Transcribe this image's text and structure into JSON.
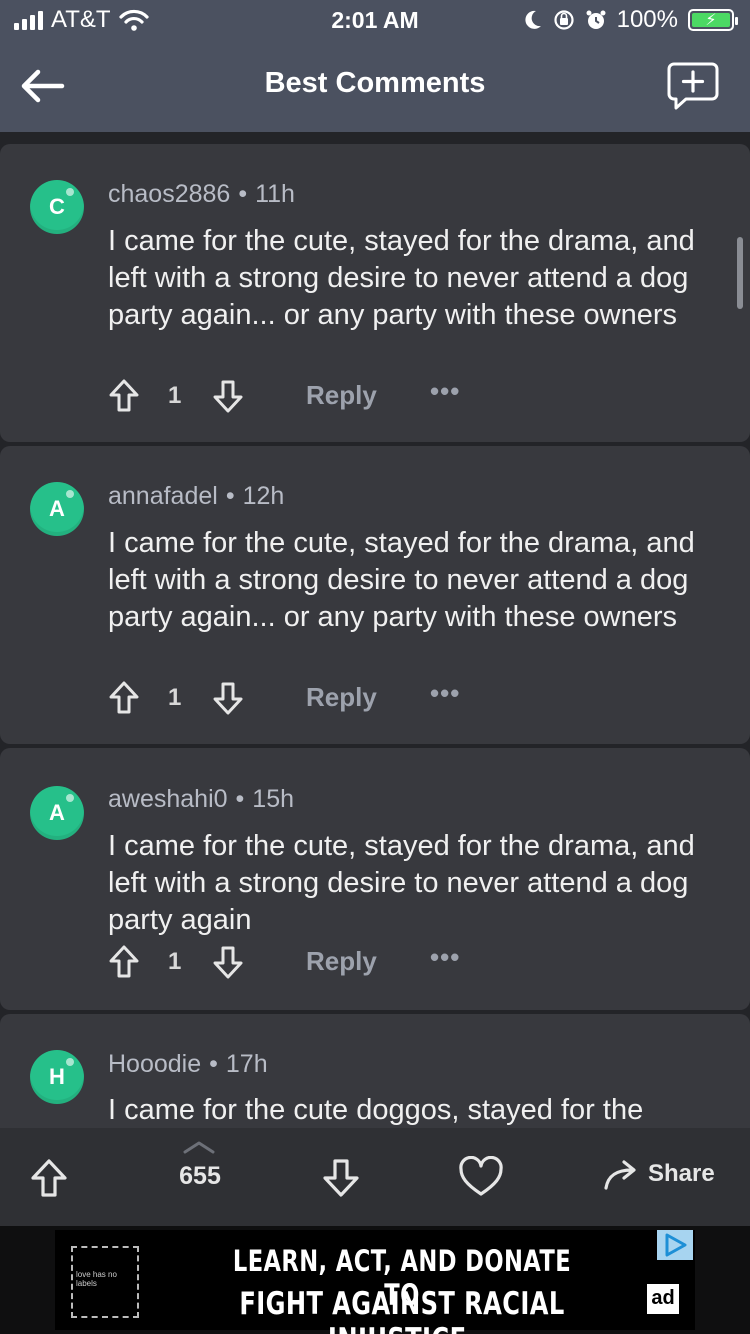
{
  "status_bar": {
    "carrier": "AT&T",
    "time": "2:01 AM",
    "battery": "100%"
  },
  "header": {
    "title": "Best Comments"
  },
  "comments": [
    {
      "avatar_letter": "C",
      "username": "chaos2886",
      "age": "11h",
      "text": "I came for the cute, stayed for the drama, and left with a strong desire to never attend a dog party again... or any party with these owners",
      "score": "1",
      "reply_label": "Reply",
      "more_label": "•••"
    },
    {
      "avatar_letter": "A",
      "username": "annafadel",
      "age": "12h",
      "text": "I came for the cute, stayed for the drama, and left with a strong desire to never attend a dog party again... or any party with these owners",
      "score": "1",
      "reply_label": "Reply",
      "more_label": "•••"
    },
    {
      "avatar_letter": "A",
      "username": "aweshahi0",
      "age": "15h",
      "text": "I came for the cute, stayed for the drama, and left with a strong desire to never attend a dog party again",
      "score": "1",
      "reply_label": "Reply",
      "more_label": "•••"
    },
    {
      "avatar_letter": "H",
      "username": "Hooodie",
      "age": "17h",
      "text": "I came for the cute doggos, stayed for the",
      "score": "",
      "reply_label": "",
      "more_label": ""
    }
  ],
  "bottom_bar": {
    "vote_count": "655",
    "share_label": "Share"
  },
  "ad": {
    "logo_text": "love has no labels",
    "line1": "LEARN, ACT, AND DONATE TO",
    "line2": "FIGHT AGAINST RACIAL INJUSTICE.",
    "badge": "ad"
  },
  "colors": {
    "header_bg": "#4b5160",
    "page_bg": "#232428",
    "card_bg": "#38393e",
    "avatar_green": "#26c08a",
    "battery_green": "#4cd964"
  }
}
